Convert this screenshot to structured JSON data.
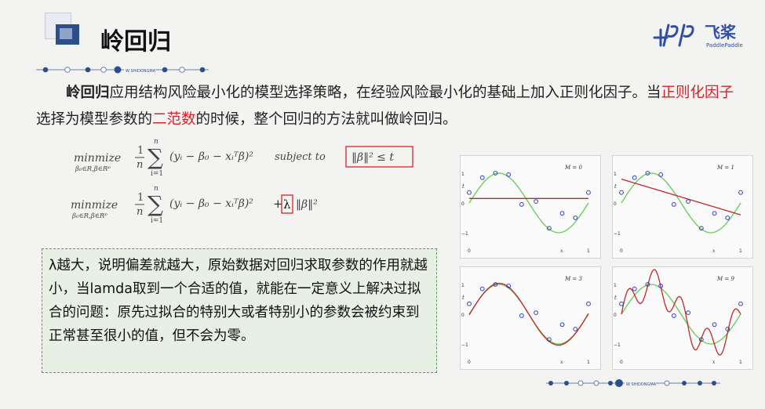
{
  "title": "岭回归",
  "logo": {
    "name": "飞桨",
    "sub": "PaddlePaddle"
  },
  "divider_text": "W SHIDONGMA",
  "paragraph": {
    "bold_lead": "岭回归",
    "text1": "应用结构风险最小化的模型选择策略，在经验风险最小化的基础上加入正则化因子。当",
    "red1": "正则化因子",
    "text2": "选择为模型参数的",
    "red2": "二范数",
    "text3": "的时候，整个回归的方法就叫做岭回归。"
  },
  "formula1": {
    "minmize": "minmize",
    "sub": "β₀∈R,β∈Rᵖ",
    "frac_num": "1",
    "frac_den": "n",
    "sum_top": "n",
    "sum_bottom": "i=1",
    "body": "(yᵢ − β₀ − xᵢᵀβ)²",
    "subject": "subject  to",
    "constraint": "‖β‖² ≤ t"
  },
  "formula2": {
    "minmize": "minmize",
    "sub": "β₀∈R,β∈Rᵖ",
    "frac_num": "1",
    "frac_den": "n",
    "sum_top": "n",
    "sum_bottom": "i=1",
    "body": "(yᵢ − β₀ − xᵢᵀβ)²",
    "plus": "+",
    "lambda": "λ",
    "norm": "‖β‖²"
  },
  "note_text": "λ越大，说明偏差就越大，原始数据对回归求取参数的作用就越小，当lamda取到一个合适的值，就能在一定意义上解决过拟合的问题：原先过拟合的特别大或者特别小的参数会被约束到正常甚至很小的值，但不会为零。",
  "panels": [
    {
      "label": "M = 0"
    },
    {
      "label": "M = 1"
    },
    {
      "label": "M = 3"
    },
    {
      "label": "M = 9"
    }
  ],
  "axis": {
    "t": "t",
    "x": "x",
    "y_ticks": [
      "1",
      "0",
      "−1"
    ],
    "x_ticks": [
      "0",
      "1"
    ]
  },
  "colors": {
    "accent_red": "#d8222a",
    "header_blue": "#2c4f8a",
    "fit_red": "#c0282a",
    "true_green": "#66cc55",
    "point_blue": "#3040c0"
  }
}
